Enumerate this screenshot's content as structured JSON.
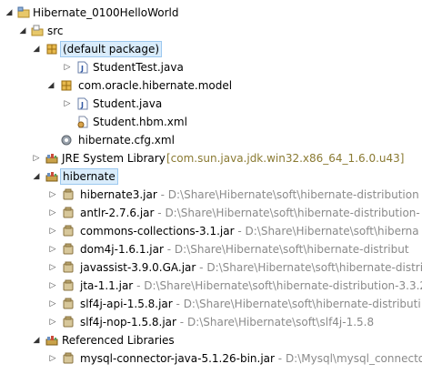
{
  "tree": {
    "project": {
      "label": "Hibernate_0100HelloWorld",
      "icon": "project-folder-icon"
    },
    "src": {
      "label": "src",
      "icon": "source-folder-icon"
    },
    "default_package": {
      "label": "(default package)",
      "icon": "package-icon"
    },
    "student_test": {
      "label": "StudentTest.java",
      "icon": "java-file-icon"
    },
    "model_package": {
      "label": "com.oracle.hibernate.model",
      "icon": "package-icon"
    },
    "student_java": {
      "label": "Student.java",
      "icon": "java-file-icon"
    },
    "student_hbm": {
      "label": "Student.hbm.xml",
      "icon": "xml-file-icon"
    },
    "cfg_xml": {
      "label": "hibernate.cfg.xml",
      "icon": "xml-config-icon"
    },
    "jre": {
      "label": "JRE System Library",
      "detail": "[com.sun.java.jdk.win32.x86_64_1.6.0.u43]",
      "icon": "library-icon"
    },
    "hibernate_lib": {
      "label": "hibernate",
      "icon": "library-icon"
    },
    "jars": [
      {
        "name": "hibernate3.jar",
        "sep": " - ",
        "path": "D:\\Share\\Hibernate\\soft\\hibernate-distribution"
      },
      {
        "name": "antlr-2.7.6.jar",
        "sep": " - ",
        "path": "D:\\Share\\Hibernate\\soft\\hibernate-distribution-"
      },
      {
        "name": "commons-collections-3.1.jar",
        "sep": " - ",
        "path": "D:\\Share\\Hibernate\\soft\\hiberna"
      },
      {
        "name": "dom4j-1.6.1.jar",
        "sep": " - ",
        "path": "D:\\Share\\Hibernate\\soft\\hibernate-distribut"
      },
      {
        "name": "javassist-3.9.0.GA.jar",
        "sep": " - ",
        "path": "D:\\Share\\Hibernate\\soft\\hibernate-distri"
      },
      {
        "name": "jta-1.1.jar",
        "sep": " - ",
        "path": "D:\\Share\\Hibernate\\soft\\hibernate-distribution-3.3.2"
      },
      {
        "name": "slf4j-api-1.5.8.jar",
        "sep": " - ",
        "path": "D:\\Share\\Hibernate\\soft\\hibernate-distributi"
      },
      {
        "name": "slf4j-nop-1.5.8.jar",
        "sep": " - ",
        "path": "D:\\Share\\Hibernate\\soft\\slf4j-1.5.8"
      }
    ],
    "referenced": {
      "label": "Referenced Libraries",
      "icon": "library-icon"
    },
    "mysql_jar": {
      "name": "mysql-connector-java-5.1.26-bin.jar",
      "sep": " - ",
      "path": "D:\\Mysql\\mysql_connector"
    }
  }
}
